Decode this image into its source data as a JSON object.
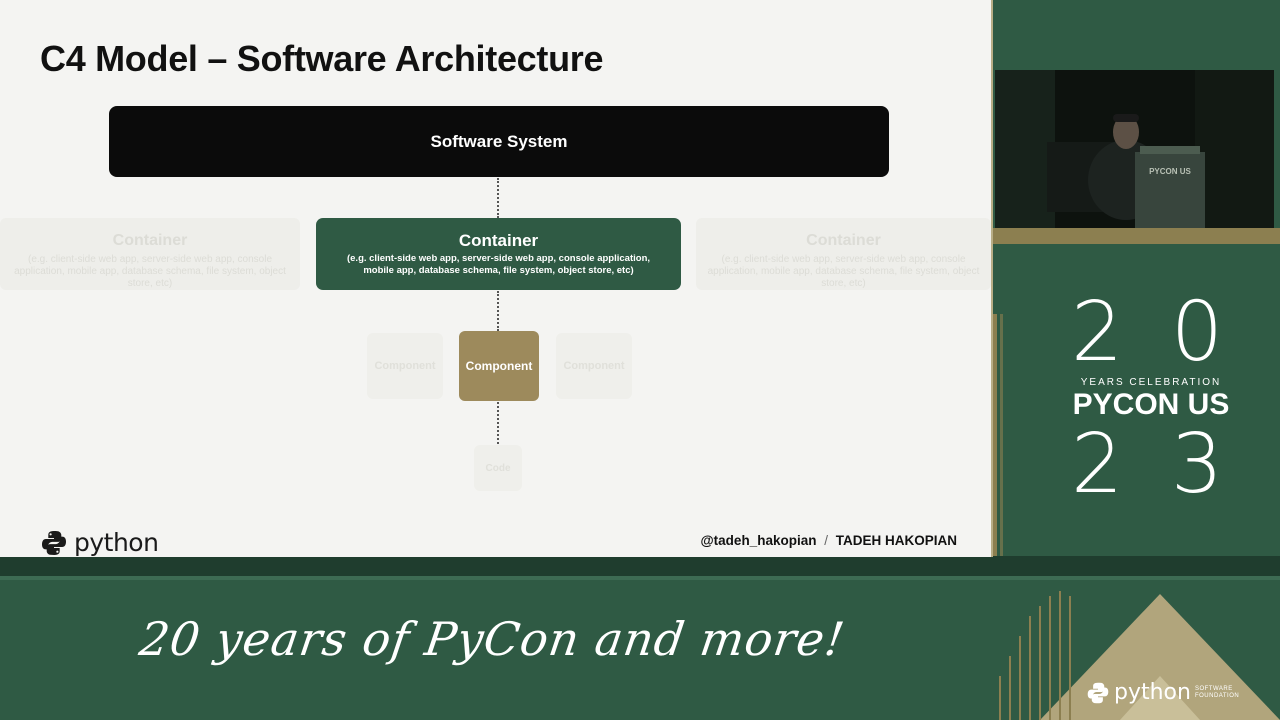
{
  "slide": {
    "title": "C4 Model – Software Architecture",
    "software_system": "Software System",
    "container_main": {
      "title": "Container",
      "description": "(e.g. client-side web app, server-side web app, console application, mobile app, database schema, file system, object store, etc)"
    },
    "container_ghost": {
      "title": "Container",
      "description": "(e.g. client-side web app, server-side web app, console application, mobile app, database schema, file system, object store, etc)"
    },
    "component": "Component",
    "code": "Code",
    "python_word": "python",
    "credit": {
      "handle": "@tadeh_hakopian",
      "separator": "/",
      "name": "TADEH HAKOPIAN"
    }
  },
  "branding": {
    "digits_top": [
      "2",
      "0"
    ],
    "years_celebration": "YEARS CELEBRATION",
    "pycon_us": "PYCON US",
    "digits_bottom": [
      "2",
      "3"
    ],
    "tagline": "20 years of PyCon and more!",
    "psf_word": "python",
    "psf_sub_1": "SOFTWARE",
    "psf_sub_2": "FOUNDATION",
    "podium_text": "PYCON US"
  },
  "colors": {
    "brand_green": "#2f5a44",
    "component_tan": "#9d8a5c",
    "system_black": "#0b0b0b"
  }
}
